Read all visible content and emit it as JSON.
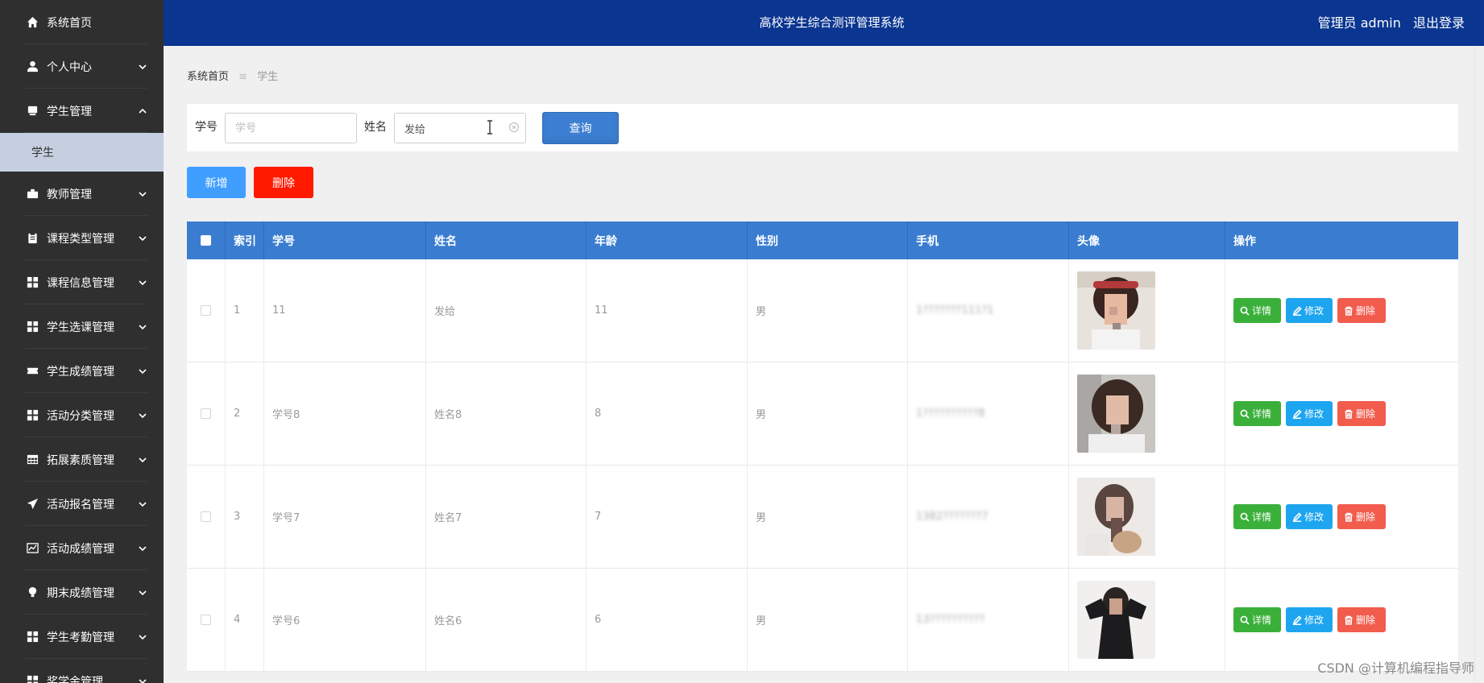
{
  "header": {
    "title": "高校学生综合测评管理系统",
    "user": "管理员 admin",
    "logout": "退出登录"
  },
  "sidebar": {
    "items": [
      {
        "label": "系统首页",
        "icon": "home-icon",
        "expandable": false
      },
      {
        "label": "个人中心",
        "icon": "user-icon",
        "expandable": true,
        "expanded": false
      },
      {
        "label": "学生管理",
        "icon": "folder-icon",
        "expandable": true,
        "expanded": true
      },
      {
        "label": "教师管理",
        "icon": "briefcase-icon",
        "expandable": true,
        "expanded": false
      },
      {
        "label": "课程类型管理",
        "icon": "clipboard-icon",
        "expandable": true,
        "expanded": false
      },
      {
        "label": "课程信息管理",
        "icon": "grid-icon",
        "expandable": true,
        "expanded": false
      },
      {
        "label": "学生选课管理",
        "icon": "grid-icon",
        "expandable": true,
        "expanded": false
      },
      {
        "label": "学生成绩管理",
        "icon": "ticket-icon",
        "expandable": true,
        "expanded": false
      },
      {
        "label": "活动分类管理",
        "icon": "grid-icon",
        "expandable": true,
        "expanded": false
      },
      {
        "label": "拓展素质管理",
        "icon": "table-icon",
        "expandable": true,
        "expanded": false
      },
      {
        "label": "活动报名管理",
        "icon": "send-icon",
        "expandable": true,
        "expanded": false
      },
      {
        "label": "活动成绩管理",
        "icon": "chart-icon",
        "expandable": true,
        "expanded": false
      },
      {
        "label": "期末成绩管理",
        "icon": "bulb-icon",
        "expandable": true,
        "expanded": false
      },
      {
        "label": "学生考勤管理",
        "icon": "grid-icon",
        "expandable": true,
        "expanded": false
      },
      {
        "label": "奖学金管理",
        "icon": "grid-icon",
        "expandable": true,
        "expanded": false
      }
    ],
    "sub_item": "学生"
  },
  "breadcrumb": {
    "home": "系统首页",
    "separator": "≡",
    "current": "学生"
  },
  "search": {
    "no_label": "学号",
    "no_placeholder": "学号",
    "no_value": "",
    "name_label": "姓名",
    "name_placeholder": "姓名",
    "name_value": "发给",
    "query_button": "查询"
  },
  "actions": {
    "add": "新增",
    "delete": "删除"
  },
  "table": {
    "columns": [
      "索引",
      "学号",
      "姓名",
      "年龄",
      "性别",
      "手机",
      "头像",
      "操作"
    ],
    "rows": [
      {
        "index": "1",
        "no": "11",
        "name": "发给",
        "age": "11",
        "sex": "男",
        "phone": "1???????111?1"
      },
      {
        "index": "2",
        "no": "学号8",
        "name": "姓名8",
        "age": "8",
        "sex": "男",
        "phone": "1??????????8"
      },
      {
        "index": "3",
        "no": "学号7",
        "name": "姓名7",
        "age": "7",
        "sex": "男",
        "phone": "1382???????7"
      },
      {
        "index": "4",
        "no": "学号6",
        "name": "姓名6",
        "age": "6",
        "sex": "男",
        "phone": "13??????????"
      }
    ],
    "op_labels": {
      "detail": "详情",
      "edit": "修改",
      "remove": "删除"
    }
  },
  "colors": {
    "header_bg": "#0a3590",
    "sidebar_bg": "#2f2f2f",
    "table_header_bg": "#3a7dd0",
    "detail_btn": "#3ab03a",
    "edit_btn": "#1ea5f0",
    "remove_btn": "#f15c4d",
    "delete_btn": "#ff1a00",
    "add_btn": "#409eff"
  },
  "watermark": "CSDN @计算机编程指导师"
}
